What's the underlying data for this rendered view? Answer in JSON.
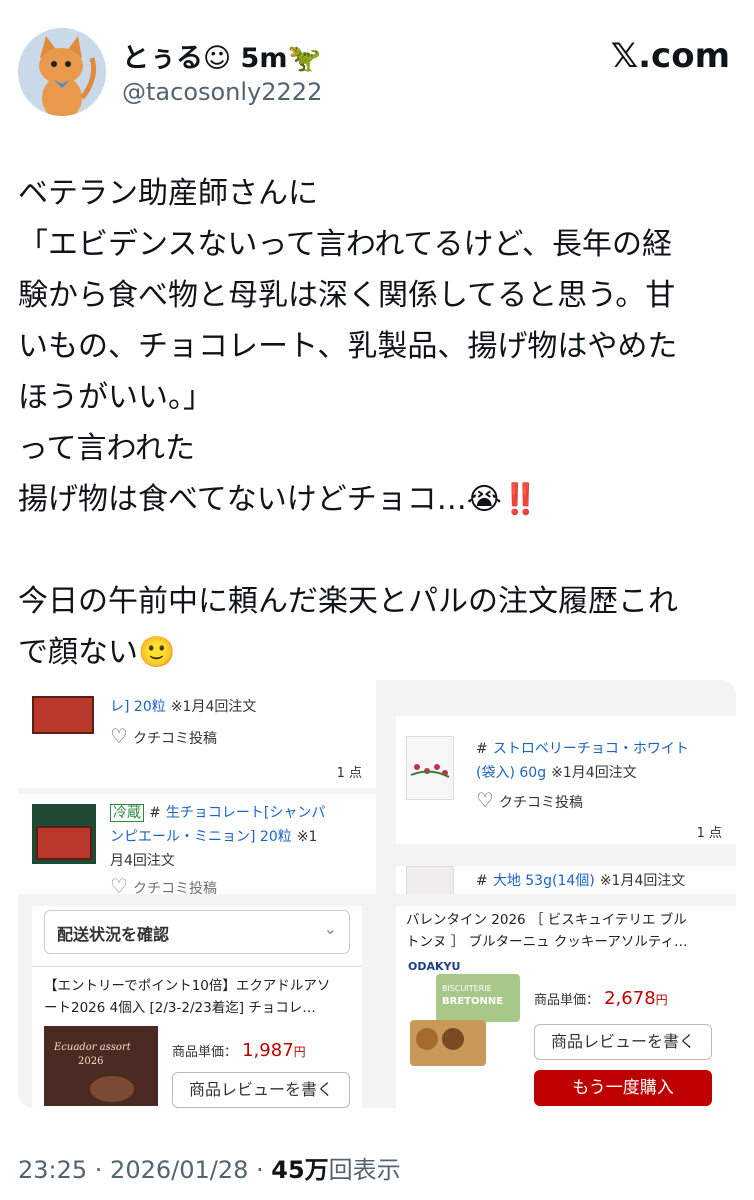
{
  "user": {
    "display_name": "とぅる☺︎ 5m🦖",
    "handle": "@tacosonly2222",
    "site": "𝕏.com"
  },
  "tweet": {
    "lines": [
      "ベテラン助産師さんに",
      "「エビデンスないって言われてるけど、長年の経",
      "験から食べ物と母乳は深く関係してると思う。甘",
      "いもの、チョコレート、乳製品、揚げ物はやめた",
      "ほうがいい。」",
      "って言われた",
      "揚げ物は食べてないけどチョコ…😭‼️",
      "",
      "今日の午前中に頼んだ楽天とパルの注文履歴これ",
      "で顔ない🙂"
    ]
  },
  "collage": {
    "p1": {
      "title": "レ] 20粒",
      "note": "※1月4回注文",
      "review": "クチコミ投稿",
      "count": "1 点"
    },
    "p2": {
      "tag": "冷蔵",
      "hash": "#",
      "title": "生チョコレート[シャンパ",
      "title2": "ンピエール・ミニョン] 20粒",
      "note1": "※1",
      "note2": "月4回注文",
      "review": "クチコミ投稿"
    },
    "p3": {
      "hash": "#",
      "title": "ストロベリーチョコ・ホワイト",
      "title2": "(袋入) 60g",
      "note": "※1月4回注文",
      "review": "クチコミ投稿",
      "count": "1 点"
    },
    "p4": {
      "hash": "#",
      "title": "大地 53g(14個)",
      "note": "※1月4回注文"
    },
    "p5": {
      "status_button": "配送状況を確認",
      "title1": "【エントリーでポイント10倍】エクアドルアソ",
      "title2": "ート2026 4個入 [2/3-2/23着迄] チョコレ…",
      "box_text1": "Ecuador assort",
      "box_text2": "2026",
      "price_label": "商品単価：",
      "price": "1,987",
      "yen": "円",
      "review_button": "商品レビューを書く"
    },
    "p6": {
      "title1": "バレンタイン 2026 ［ ビスキュイテリエ ブル",
      "title2": "トンヌ ］ ブルターニュ クッキーアソルティ…",
      "brand": "ODAKYU",
      "box_label1": "BISCUITERIE",
      "box_label2": "BRETONNE",
      "price_label": "商品単価：",
      "price": "2,678",
      "yen": "円",
      "review_button": "商品レビューを書く",
      "buy_button": "もう一度購入"
    }
  },
  "footer": {
    "time": "23:25 · 2026/01/28 · ",
    "views": "45万",
    "views_label": "回表示"
  }
}
